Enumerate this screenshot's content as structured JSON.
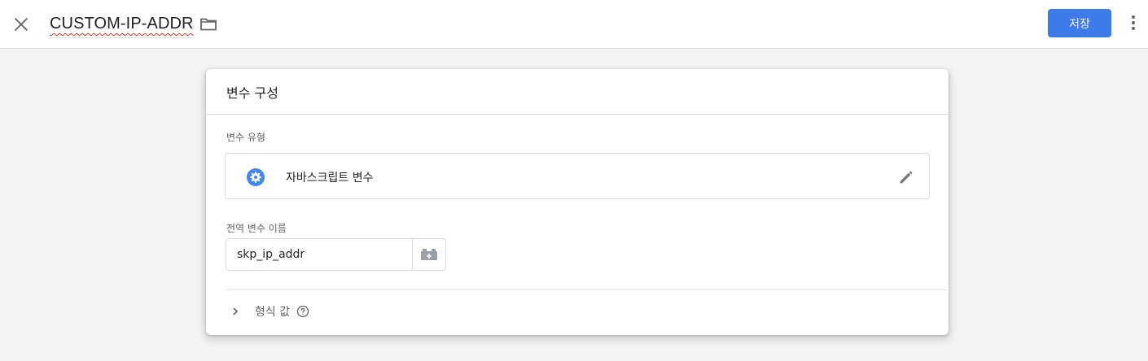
{
  "header": {
    "title": "CUSTOM-IP-ADDR",
    "save_label": "저장",
    "accent_color": "#3c7be8"
  },
  "icons": {
    "close": "close-icon",
    "folder": "folder-icon",
    "more": "more-vert-icon",
    "type": "gear-icon",
    "edit": "pencil-icon",
    "variable_picker": "variable-block-add-icon",
    "expand": "chevron-right-icon",
    "help": "help-circle-icon"
  },
  "card": {
    "title": "변수 구성",
    "type_label": "변수 유형",
    "type_name": "자바스크립트 변수",
    "name_label": "전역 변수 이름",
    "name_value": "skp_ip_addr",
    "format_label": "형식 값"
  }
}
